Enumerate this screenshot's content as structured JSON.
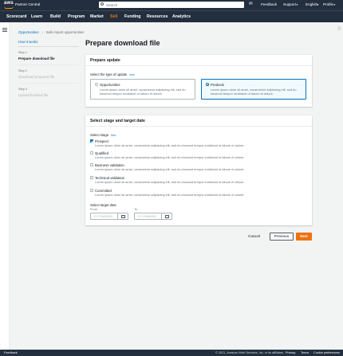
{
  "header": {
    "logo_text": "aws",
    "app_title": "Partner Central",
    "search_placeholder": "Search",
    "links": [
      "Feedback",
      "Support",
      "English",
      "Profile"
    ]
  },
  "nav": {
    "items": [
      "Scorecard",
      "Learn",
      "Build",
      "Program",
      "Market",
      "Sell",
      "Funding",
      "Resources",
      "Analytics"
    ],
    "active": "Sell"
  },
  "breadcrumb": {
    "root": "Opportunities",
    "current": "Bulk import opportunities"
  },
  "wizard": {
    "how_it_works": "How it works",
    "steps": [
      {
        "number": "Step 1",
        "name": "Prepare download file"
      },
      {
        "number": "Step 2",
        "name": "Download prepared file"
      },
      {
        "number": "Step 3",
        "name": "Upload finished file"
      }
    ]
  },
  "page_title": "Prepare download file",
  "prepare_update": {
    "heading": "Prepare update",
    "field_label": "Select the type of update",
    "info": "Info",
    "options": [
      {
        "title": "Opportunities",
        "desc": "Lorem ipsum dolor sit amet, consectetur adipiscing elit, sed do eiusmod tempor incididunt ut labore et dolore.",
        "selected": false
      },
      {
        "title": "Products",
        "desc": "Lorem ipsum dolor sit amet, consectetur adipiscing elit, sed do eiusmod tempor incididunt ut labore et dolore.",
        "selected": true
      }
    ]
  },
  "stage_section": {
    "heading": "Select stage and target date",
    "stage_label": "Select stage",
    "info": "Info",
    "stages": [
      {
        "title": "Prospect",
        "desc": "Lorem ipsum dolor sit amet, consectetur adipiscing elit, sed do eiusmod tempor incididunt ut labore et dolore.",
        "checked": true
      },
      {
        "title": "Qualified",
        "desc": "Lorem ipsum dolor sit amet, consectetur adipiscing elit, sed do eiusmod tempor incididunt ut labore et dolore.",
        "checked": false
      },
      {
        "title": "Business validation",
        "desc": "Lorem ipsum dolor sit amet, consectetur adipiscing elit, sed do eiusmod tempor incididunt ut labore et dolore.",
        "checked": false
      },
      {
        "title": "Technical validation",
        "desc": "Lorem ipsum dolor sit amet, consectetur adipiscing elit, sed do eiusmod tempor incididunt ut labore et dolore.",
        "checked": false
      },
      {
        "title": "Committed",
        "desc": "Lorem ipsum dolor sit amet, consectetur adipiscing elit, sed do eiusmod tempor incididunt ut labore et dolore.",
        "checked": false
      }
    ],
    "target_date_label": "Select target date",
    "from_label": "From",
    "to_label": "To",
    "from_placeholder": "YYYY/MM/DD",
    "to_placeholder": "YYYY/MM/DD"
  },
  "actions": {
    "cancel": "Cancel",
    "previous": "Previous",
    "next": "Next"
  },
  "footer": {
    "feedback": "Feedback",
    "copyright": "© 2021, Amazon Web Services, Inc. or its affiliates.",
    "links": [
      "Privacy",
      "Terms",
      "Cookie preferences"
    ]
  },
  "colors": {
    "header_bg": "#232f3e",
    "accent": "#ec7211",
    "link": "#0073bb"
  }
}
